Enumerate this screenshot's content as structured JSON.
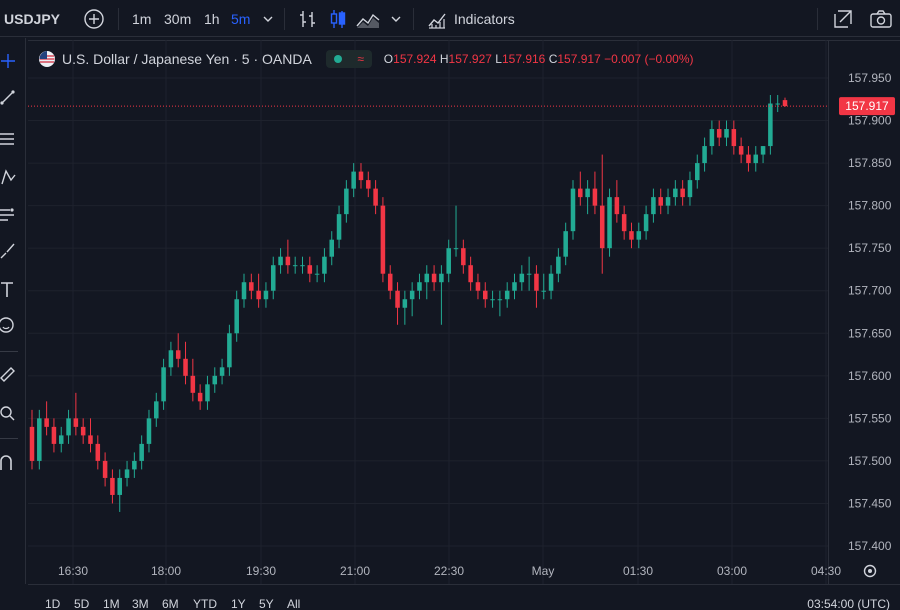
{
  "toolbar": {
    "symbol": "USDJPY",
    "intervals": [
      "1m",
      "30m",
      "1h",
      "5m"
    ],
    "active_interval": "5m",
    "indicators_label": "Indicators"
  },
  "legend": {
    "title": "U.S. Dollar / Japanese Yen · 5 · OANDA",
    "o_label": "O",
    "o": "157.924",
    "h_label": "H",
    "h": "157.927",
    "l_label": "L",
    "l": "157.916",
    "c_label": "C",
    "c": "157.917",
    "change": "−0.007 (−0.00%)"
  },
  "colors": {
    "up": "#22ab94",
    "down": "#f23645",
    "bg": "#131722",
    "grid": "#1e222d",
    "accent": "#2962ff"
  },
  "price_axis": {
    "ticks": [
      "157.950",
      "157.900",
      "157.850",
      "157.800",
      "157.750",
      "157.700",
      "157.650",
      "157.600",
      "157.550",
      "157.500",
      "157.450",
      "157.400"
    ],
    "last_price": "157.917"
  },
  "time_axis": {
    "ticks": [
      "16:30",
      "18:00",
      "19:30",
      "21:00",
      "22:30",
      "May",
      "01:30",
      "03:00",
      "04:30"
    ]
  },
  "timeframes": [
    "1D",
    "5D",
    "1M",
    "3M",
    "6M",
    "YTD",
    "1Y",
    "5Y",
    "All"
  ],
  "clock": "03:54:00 (UTC)",
  "chart_data": {
    "type": "candlestick",
    "ylim": [
      157.39,
      157.96
    ],
    "candles": [
      [
        157.54,
        157.56,
        157.49,
        157.5
      ],
      [
        157.5,
        157.56,
        157.49,
        157.55
      ],
      [
        157.55,
        157.57,
        157.53,
        157.54
      ],
      [
        157.54,
        157.55,
        157.51,
        157.52
      ],
      [
        157.52,
        157.54,
        157.51,
        157.53
      ],
      [
        157.53,
        157.56,
        157.52,
        157.55
      ],
      [
        157.55,
        157.58,
        157.53,
        157.54
      ],
      [
        157.54,
        157.55,
        157.52,
        157.53
      ],
      [
        157.53,
        157.55,
        157.51,
        157.52
      ],
      [
        157.52,
        157.53,
        157.49,
        157.5
      ],
      [
        157.5,
        157.51,
        157.47,
        157.48
      ],
      [
        157.48,
        157.49,
        157.45,
        157.46
      ],
      [
        157.46,
        157.49,
        157.44,
        157.48
      ],
      [
        157.48,
        157.5,
        157.47,
        157.49
      ],
      [
        157.49,
        157.51,
        157.48,
        157.5
      ],
      [
        157.5,
        157.53,
        157.49,
        157.52
      ],
      [
        157.52,
        157.56,
        157.51,
        157.55
      ],
      [
        157.55,
        157.58,
        157.54,
        157.57
      ],
      [
        157.57,
        157.62,
        157.56,
        157.61
      ],
      [
        157.61,
        157.64,
        157.6,
        157.63
      ],
      [
        157.63,
        157.65,
        157.61,
        157.62
      ],
      [
        157.62,
        157.64,
        157.59,
        157.6
      ],
      [
        157.6,
        157.62,
        157.57,
        157.58
      ],
      [
        157.58,
        157.59,
        157.56,
        157.57
      ],
      [
        157.57,
        157.6,
        157.56,
        157.59
      ],
      [
        157.59,
        157.61,
        157.58,
        157.6
      ],
      [
        157.6,
        157.62,
        157.59,
        157.61
      ],
      [
        157.61,
        157.66,
        157.6,
        157.65
      ],
      [
        157.65,
        157.7,
        157.64,
        157.69
      ],
      [
        157.69,
        157.72,
        157.68,
        157.71
      ],
      [
        157.71,
        157.72,
        157.69,
        157.7
      ],
      [
        157.7,
        157.72,
        157.68,
        157.69
      ],
      [
        157.69,
        157.71,
        157.68,
        157.7
      ],
      [
        157.7,
        157.74,
        157.69,
        157.73
      ],
      [
        157.73,
        157.75,
        157.72,
        157.74
      ],
      [
        157.74,
        157.76,
        157.72,
        157.73
      ],
      [
        157.73,
        157.74,
        157.72,
        157.73
      ],
      [
        157.73,
        157.74,
        157.72,
        157.73
      ],
      [
        157.73,
        157.74,
        157.71,
        157.72
      ],
      [
        157.72,
        157.73,
        157.71,
        157.72
      ],
      [
        157.72,
        157.75,
        157.71,
        157.74
      ],
      [
        157.74,
        157.77,
        157.73,
        157.76
      ],
      [
        157.76,
        157.8,
        157.75,
        157.79
      ],
      [
        157.79,
        157.83,
        157.78,
        157.82
      ],
      [
        157.82,
        157.85,
        157.81,
        157.84
      ],
      [
        157.84,
        157.85,
        157.82,
        157.83
      ],
      [
        157.83,
        157.84,
        157.81,
        157.82
      ],
      [
        157.82,
        157.83,
        157.79,
        157.8
      ],
      [
        157.8,
        157.81,
        157.71,
        157.72
      ],
      [
        157.72,
        157.73,
        157.69,
        157.7
      ],
      [
        157.7,
        157.71,
        157.66,
        157.68
      ],
      [
        157.68,
        157.7,
        157.66,
        157.69
      ],
      [
        157.69,
        157.71,
        157.67,
        157.7
      ],
      [
        157.7,
        157.72,
        157.69,
        157.71
      ],
      [
        157.71,
        157.73,
        157.69,
        157.72
      ],
      [
        157.72,
        157.73,
        157.7,
        157.71
      ],
      [
        157.71,
        157.73,
        157.66,
        157.72
      ],
      [
        157.72,
        157.76,
        157.71,
        157.75
      ],
      [
        157.75,
        157.8,
        157.74,
        157.75
      ],
      [
        157.75,
        157.76,
        157.72,
        157.73
      ],
      [
        157.73,
        157.74,
        157.7,
        157.71
      ],
      [
        157.71,
        157.72,
        157.69,
        157.7
      ],
      [
        157.7,
        157.71,
        157.68,
        157.69
      ],
      [
        157.69,
        157.7,
        157.68,
        157.69
      ],
      [
        157.69,
        157.7,
        157.67,
        157.69
      ],
      [
        157.69,
        157.71,
        157.68,
        157.7
      ],
      [
        157.7,
        157.72,
        157.69,
        157.71
      ],
      [
        157.71,
        157.73,
        157.7,
        157.72
      ],
      [
        157.72,
        157.74,
        157.7,
        157.72
      ],
      [
        157.72,
        157.73,
        157.68,
        157.7
      ],
      [
        157.7,
        157.72,
        157.69,
        157.7
      ],
      [
        157.7,
        157.73,
        157.69,
        157.72
      ],
      [
        157.72,
        157.75,
        157.71,
        157.74
      ],
      [
        157.74,
        157.78,
        157.73,
        157.77
      ],
      [
        157.77,
        157.83,
        157.76,
        157.82
      ],
      [
        157.82,
        157.84,
        157.8,
        157.81
      ],
      [
        157.81,
        157.83,
        157.79,
        157.82
      ],
      [
        157.82,
        157.84,
        157.79,
        157.8
      ],
      [
        157.8,
        157.86,
        157.72,
        157.75
      ],
      [
        157.75,
        157.82,
        157.74,
        157.81
      ],
      [
        157.81,
        157.83,
        157.78,
        157.79
      ],
      [
        157.79,
        157.8,
        157.76,
        157.77
      ],
      [
        157.77,
        157.78,
        157.75,
        157.76
      ],
      [
        157.76,
        157.78,
        157.75,
        157.77
      ],
      [
        157.77,
        157.8,
        157.76,
        157.79
      ],
      [
        157.79,
        157.82,
        157.78,
        157.81
      ],
      [
        157.81,
        157.82,
        157.79,
        157.8
      ],
      [
        157.8,
        157.82,
        157.79,
        157.81
      ],
      [
        157.81,
        157.83,
        157.8,
        157.82
      ],
      [
        157.82,
        157.83,
        157.8,
        157.81
      ],
      [
        157.81,
        157.84,
        157.8,
        157.83
      ],
      [
        157.83,
        157.86,
        157.82,
        157.85
      ],
      [
        157.85,
        157.88,
        157.84,
        157.87
      ],
      [
        157.87,
        157.9,
        157.86,
        157.89
      ],
      [
        157.89,
        157.9,
        157.87,
        157.88
      ],
      [
        157.88,
        157.9,
        157.87,
        157.89
      ],
      [
        157.89,
        157.9,
        157.86,
        157.87
      ],
      [
        157.87,
        157.88,
        157.85,
        157.86
      ],
      [
        157.86,
        157.87,
        157.84,
        157.85
      ],
      [
        157.85,
        157.87,
        157.84,
        157.86
      ],
      [
        157.86,
        157.87,
        157.85,
        157.87
      ],
      [
        157.87,
        157.93,
        157.86,
        157.92
      ],
      [
        157.92,
        157.93,
        157.91,
        157.92
      ],
      [
        157.924,
        157.927,
        157.916,
        157.917
      ]
    ]
  }
}
